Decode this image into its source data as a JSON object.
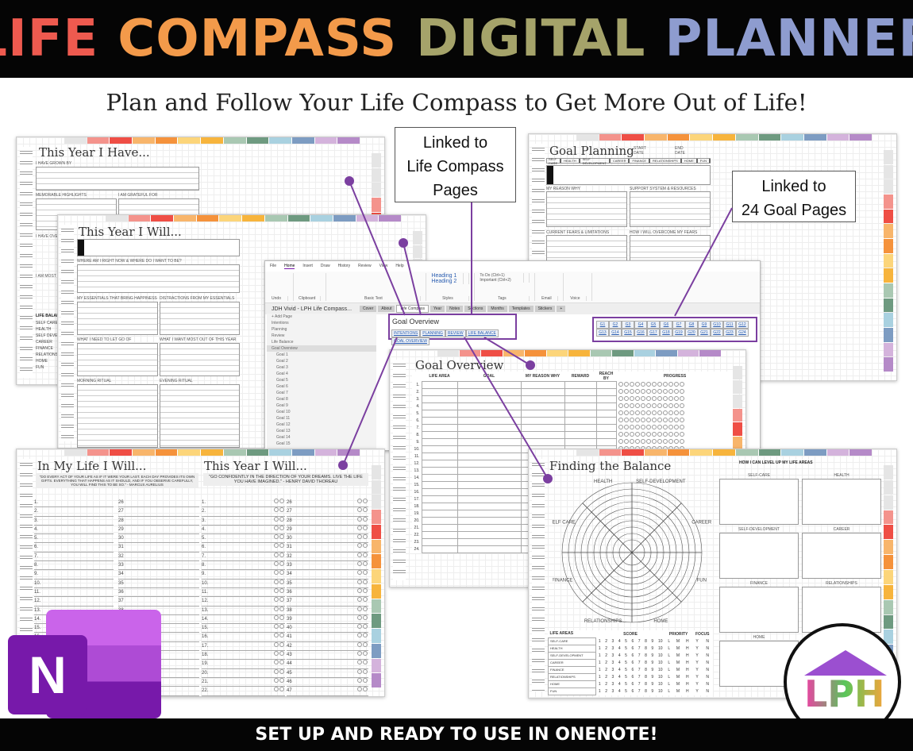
{
  "banner": {
    "title_words": [
      {
        "text": "LIFE",
        "color": "#ee5a4f"
      },
      {
        "text": "COMPASS",
        "color": "#f39a4a"
      },
      {
        "text": "DIGITAL",
        "color": "#a5a36a"
      },
      {
        "text": "PLANNER",
        "color": "#8e9ccf"
      }
    ]
  },
  "subtitle": "Plan and Follow Your Life Compass to Get More Out of Life!",
  "footer": "SET UP AND READY TO USE IN ONENOTE!",
  "colors": {
    "tabs": [
      "#e5e5e5",
      "#f4938c",
      "#ef4e45",
      "#f8b56b",
      "#f5923b",
      "#fcd57a",
      "#f7b43c",
      "#a9c8b2",
      "#6e9a80",
      "#a9d1e0",
      "#7d9cc2",
      "#d4b3dc",
      "#b58ac8"
    ],
    "accent": "#7b3fa0"
  },
  "callouts": {
    "life_compass": [
      "Linked to",
      "Life Compass",
      "Pages"
    ],
    "goal_pages": [
      "Linked to",
      "24 Goal Pages"
    ]
  },
  "page_have": {
    "title": "This Year I Have...",
    "labels": [
      "I HAVE GROWN BY",
      "MEMORABLE HIGHLIGHTS",
      "I AM GRATEFUL FOR",
      "I HAVE OVER",
      "I AM MOST P"
    ],
    "life_balance": "LIFE BALAN",
    "areas": [
      "SELF CARE",
      "HEALTH",
      "SELF DEVEL",
      "CAREER",
      "FINANCE",
      "RELATIONSH",
      "HOME",
      "FUN"
    ]
  },
  "page_will": {
    "title": "This Year I Will...",
    "labels": [
      "WHERE AM I RIGHT NOW & WHERE DO I WANT TO BE?",
      "MY ESSENTIALS THAT BRING HAPPINESS",
      "DISTRACTIONS FROM MY ESSENTIALS",
      "WHAT I NEED TO LET GO OF",
      "WHAT I WANT MOST OUT OF THIS YEAR",
      "MORNING RITUAL",
      "EVENING RITUAL"
    ]
  },
  "page_goal": {
    "title": "Goal Planning",
    "start": "START DATE",
    "end": "END DATE",
    "areas": [
      "SELF CARE",
      "HEALTH",
      "SELF DEVELOPMENT",
      "CAREER",
      "FINANCE",
      "RELATIONSHIPS",
      "HOME",
      "FUN"
    ],
    "labels": [
      "MY REASON WHY",
      "SUPPORT SYSTEM & RESOURCES",
      "CURRENT FEARS & LIMITATIONS",
      "HOW I WILL OVERCOME MY FEARS"
    ]
  },
  "onenote": {
    "menu": [
      "File",
      "Home",
      "Insert",
      "Draw",
      "History",
      "Review",
      "View",
      "Help"
    ],
    "ribbon": [
      "Undo",
      "Clipboard",
      "Basic Text",
      "Styles",
      "Tags",
      "Email",
      "Voice"
    ],
    "styles": [
      "Heading 1",
      "Heading 2"
    ],
    "tags": [
      "To Do (Ctrl+1)",
      "Important (Ctrl+2)"
    ],
    "notebook": "JDH Vivid - LPH Life Compass...",
    "sections": [
      "Cover",
      "About",
      "Life Compass",
      "Year",
      "Notes",
      "Sections",
      "Months",
      "Templates",
      "Stickers",
      "+"
    ],
    "add_page": "+ Add Page",
    "pages": [
      "Intentions",
      "Planning",
      "Review",
      "Life Balance",
      "Goal Overview",
      "Goal 1",
      "Goal 2",
      "Goal 3",
      "Goal 4",
      "Goal 5",
      "Goal 6",
      "Goal 7",
      "Goal 8",
      "Goal 9",
      "Goal 10",
      "Goal 11",
      "Goal 12",
      "Goal 13",
      "Goal 14",
      "Goal 15"
    ],
    "page_title": "Goal Overview",
    "nav_links": [
      "INTENTIONS",
      "PLANNING",
      "REVIEW",
      "LIFE BALANCE",
      "GOAL OVERVIEW"
    ],
    "goal_links": [
      "G1",
      "G2",
      "G3",
      "G4",
      "G5",
      "G6",
      "G7",
      "G8",
      "G9",
      "G10",
      "G11",
      "G12",
      "G13",
      "G14",
      "G15",
      "G16",
      "G17",
      "G18",
      "G19",
      "G20",
      "G21",
      "G22",
      "G23",
      "G24"
    ]
  },
  "page_overview": {
    "title": "Goal Overview",
    "columns": [
      "LIFE AREA",
      "GOAL",
      "MY REASON WHY",
      "REWARD",
      "REACH BY",
      "PROGRESS"
    ],
    "rows": 24
  },
  "page_life": {
    "title_left": "In My Life I Will...",
    "title_right": "This Year I Will...",
    "quote_left": "\"DO EVERY ACT OF YOUR LIFE AS IF IT WERE YOUR LAST. EACH DAY PROVIDES ITS OWN GIFTS. EVERYTHING THAT HAPPENS AS IT SHOULD, AND IF YOU OBSERVE CAREFULLY, YOU WILL FIND THIS TO BE SO.\" - MARCUS AURELIUS",
    "quote_right": "\"GO CONFIDENTLY IN THE DIRECTION OF YOUR DREAMS. LIVE THE LIFE YOU HAVE IMAGINED.\" - HENRY DAVID THOREAU"
  },
  "page_balance": {
    "title": "Finding the Balance",
    "levelup": "HOW I CAN LEVEL UP MY LIFE AREAS",
    "wheel_labels": [
      "HEALTH",
      "SELF-DEVELOPMENT",
      "CAREER",
      "FUN",
      "HOME",
      "RELATIONSHIPS",
      "FINANCE",
      "SELF CARE"
    ],
    "boxes": [
      "SELF-CARE",
      "HEALTH",
      "SELF-DEVELOPMENT",
      "CAREER",
      "FINANCE",
      "RELATIONSHIPS",
      "HOME"
    ],
    "table_headers": [
      "LIFE AREAS",
      "SCORE",
      "PRIORITY",
      "FOCUS"
    ],
    "areas": [
      "SELF-CARE",
      "HEALTH",
      "SELF-DEVELOPMENT",
      "CAREER",
      "FINANCE",
      "RELATIONSHIPS",
      "HOME",
      "FUN"
    ],
    "priority": [
      "L",
      "M",
      "H"
    ],
    "focus": [
      "Y",
      "N"
    ]
  },
  "logos": {
    "onenote": "N",
    "lph": "LPH"
  }
}
